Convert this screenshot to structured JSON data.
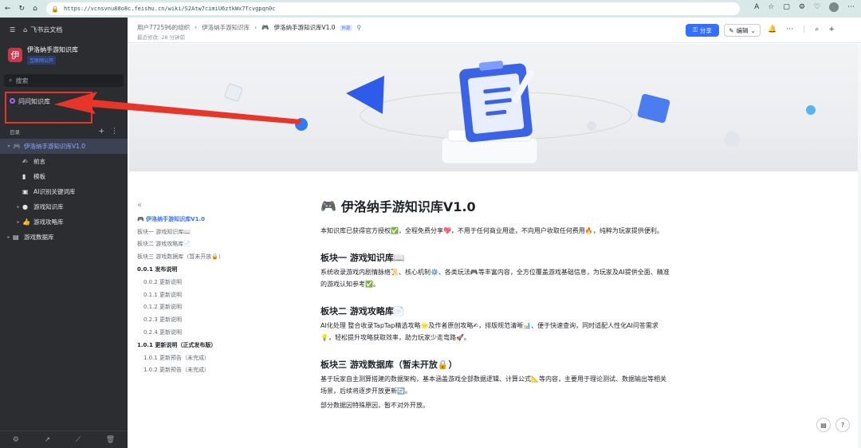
{
  "browser": {
    "url": "https://vcnsvnu88o8c.feishu.cn/wiki/S2Atw7cimiU6ztkWx7Tcvgpqn0c",
    "zoom_label": "A"
  },
  "sidebar": {
    "app_title": "飞书云文档",
    "space_name": "伊洛纳手游知识库",
    "space_logo": "伊",
    "space_tag": "互联网公开",
    "search_placeholder": "搜索",
    "ask_label": "问问知识库",
    "toc_label": "目录",
    "tree": [
      {
        "label": "伊洛纳手游知识库V1.0",
        "icon": "🎮",
        "caret": "▾",
        "level": 0,
        "active": true
      },
      {
        "label": "前言",
        "icon": "✍",
        "caret": "",
        "level": 1,
        "active": false
      },
      {
        "label": "模板",
        "icon": "▮",
        "caret": "",
        "level": 1,
        "active": false
      },
      {
        "label": "AI识别关键词库",
        "icon": "▣",
        "caret": "",
        "level": 1,
        "active": false
      },
      {
        "label": "游戏知识库",
        "icon": "●",
        "caret": "▸",
        "level": 1,
        "active": false
      },
      {
        "label": "游戏攻略库",
        "icon": "👍",
        "caret": "▸",
        "level": 1,
        "active": false
      },
      {
        "label": "游戏数据库",
        "icon": "▤",
        "caret": "▸",
        "level": 0,
        "active": false
      }
    ]
  },
  "header": {
    "breadcrumb": [
      "用户772596的组织",
      "伊洛纳手游知识库"
    ],
    "current_page": "伊洛纳手游知识库V1.0",
    "page_tag": "外部",
    "last_edit": "最近修改: 28 分钟前",
    "share_label": "分享",
    "edit_label": "编辑"
  },
  "outline": {
    "items": [
      {
        "label": "🎮 伊洛纳手游知识库V1.0",
        "kind": "h1"
      },
      {
        "label": "板块一 游戏知识库📖",
        "kind": "l1"
      },
      {
        "label": "板块二 游戏攻略库📄",
        "kind": "l1"
      },
      {
        "label": "板块三 游戏数据库（暂未开放🔒）",
        "kind": "l1"
      },
      {
        "label": "0.0.1 发布说明",
        "kind": "h2"
      },
      {
        "label": "0.0.2 更新说明",
        "kind": "l2"
      },
      {
        "label": "0.1.1 更新说明",
        "kind": "l2"
      },
      {
        "label": "0.1.2 更新说明",
        "kind": "l2"
      },
      {
        "label": "0.2.3 更新说明",
        "kind": "l2"
      },
      {
        "label": "0.2.4 更新说明",
        "kind": "l2"
      },
      {
        "label": "1.0.1 更新说明（正式发布版）",
        "kind": "h2"
      },
      {
        "label": "1.0.1 更新预告（未完成）",
        "kind": "l2"
      },
      {
        "label": "1.0.2 更新预告（未完成）",
        "kind": "l2"
      }
    ]
  },
  "doc": {
    "title": "伊洛纳手游知识库V1.0",
    "title_icon": "🎮",
    "intro": "本知识库已获得官方授权✅，全程免费分享💖，不用于任何商业用途，不向用户收取任何费用🔥，纯粹为玩家提供便利。",
    "sec1_title": "板块一 游戏知识库📖",
    "sec1_body": "系统收录游戏内剧情脉络📜、核心机制⚙️、各类玩法🎮等丰富内容，全方位覆盖游戏基础信息，为玩家及AI提供全面、精准的游戏认知参考✅。",
    "sec2_title": "板块二 游戏攻略库📄",
    "sec2_body": "AI化处理 整合收录TapTap精选攻略🌟及作者原创攻略✍，排版规范清晰📊、便于快速查询，同时适配人性化AI问答需求💡，轻松提升攻略获取效率，助力玩家少走弯路🚀。",
    "sec3_title": "板块三 游戏数据库（暂未开放🔒）",
    "sec3_body": "基于玩家自主测算搭建的数据架构，基本涵盖游戏全部数据逻辑、计算公式📐等内容，主要用于理论测试、数据输出等相关场景，后续将逐步开放更新🔄。",
    "sec3_note": "部分数据因特殊原因，暂不对外开放。"
  },
  "colors": {
    "accent": "#3370ff",
    "sidebar_bg": "#2c2d30",
    "annotation_red": "#e8352a"
  }
}
